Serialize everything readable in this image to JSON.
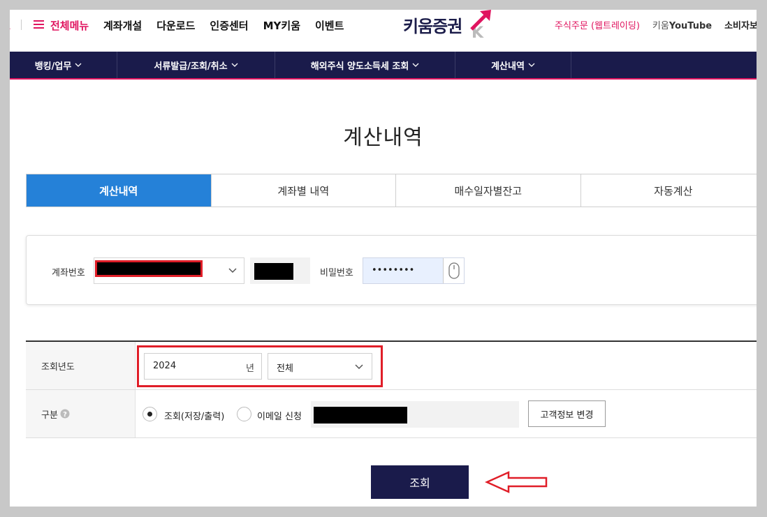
{
  "header": {
    "menu_all": "전체메뉴",
    "nav": [
      "계좌개설",
      "다운로드",
      "인증센터",
      "MY키움",
      "이벤트"
    ],
    "logo": "키움증권",
    "utility": {
      "order": "주식주문 (웹트레이딩)",
      "youtube_prefix": "키움",
      "youtube_brand": "YouTube",
      "consumer": "소비자보호포"
    }
  },
  "subnav": [
    {
      "label": "뱅킹/업무"
    },
    {
      "label": "서류발급/조회/취소"
    },
    {
      "label": "해외주식 양도소득세 조회"
    },
    {
      "label": "계산내역"
    }
  ],
  "page_title": "계산내역",
  "tabs": [
    {
      "label": "계산내역",
      "active": true
    },
    {
      "label": "계좌별 내역",
      "active": false
    },
    {
      "label": "매수일자별잔고",
      "active": false
    },
    {
      "label": "자동계산",
      "active": false
    }
  ],
  "account": {
    "label": "계좌번호",
    "password_label": "비밀번호",
    "password_value": "••••••••"
  },
  "form": {
    "year_label": "조회년도",
    "year_value": "2024",
    "year_unit": "년",
    "period_value": "전체",
    "type_label": "구분",
    "radio_view": "조회(저장/출력)",
    "radio_email": "이메일 신청",
    "change_button": "고객정보 변경"
  },
  "search_button": "조회",
  "colors": {
    "brand_pink": "#e0145f",
    "navy": "#1a1b4b",
    "tab_active": "#2581d8",
    "annotation_red": "#e01e28"
  }
}
